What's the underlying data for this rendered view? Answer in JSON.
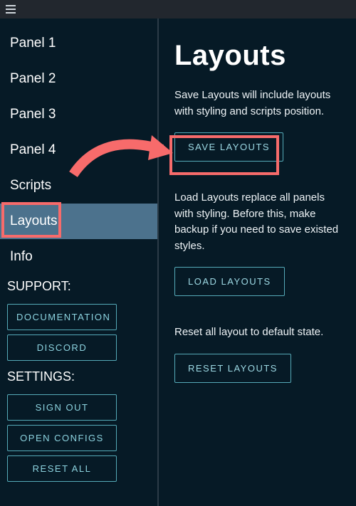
{
  "sidebar": {
    "items": [
      {
        "label": "Panel 1"
      },
      {
        "label": "Panel 2"
      },
      {
        "label": "Panel 3"
      },
      {
        "label": "Panel 4"
      },
      {
        "label": "Scripts"
      },
      {
        "label": "Layouts"
      },
      {
        "label": "Info"
      }
    ],
    "support_heading": "SUPPORT:",
    "support_buttons": [
      {
        "label": "DOCUMENTATION"
      },
      {
        "label": "DISCORD"
      }
    ],
    "settings_heading": "SETTINGS:",
    "settings_buttons": [
      {
        "label": "SIGN OUT"
      },
      {
        "label": "OPEN CONFIGS"
      },
      {
        "label": "RESET ALL"
      }
    ]
  },
  "main": {
    "title": "Layouts",
    "save_text": "Save Layouts will include layouts with styling and scripts position.",
    "save_button": "SAVE LAYOUTS",
    "load_text": "Load Layouts replace all panels with styling. Before this, make backup if you need to save existed styles.",
    "load_button": "LOAD LAYOUTS",
    "reset_text": "Reset all layout to default state.",
    "reset_button": "RESET LAYOUTS"
  }
}
